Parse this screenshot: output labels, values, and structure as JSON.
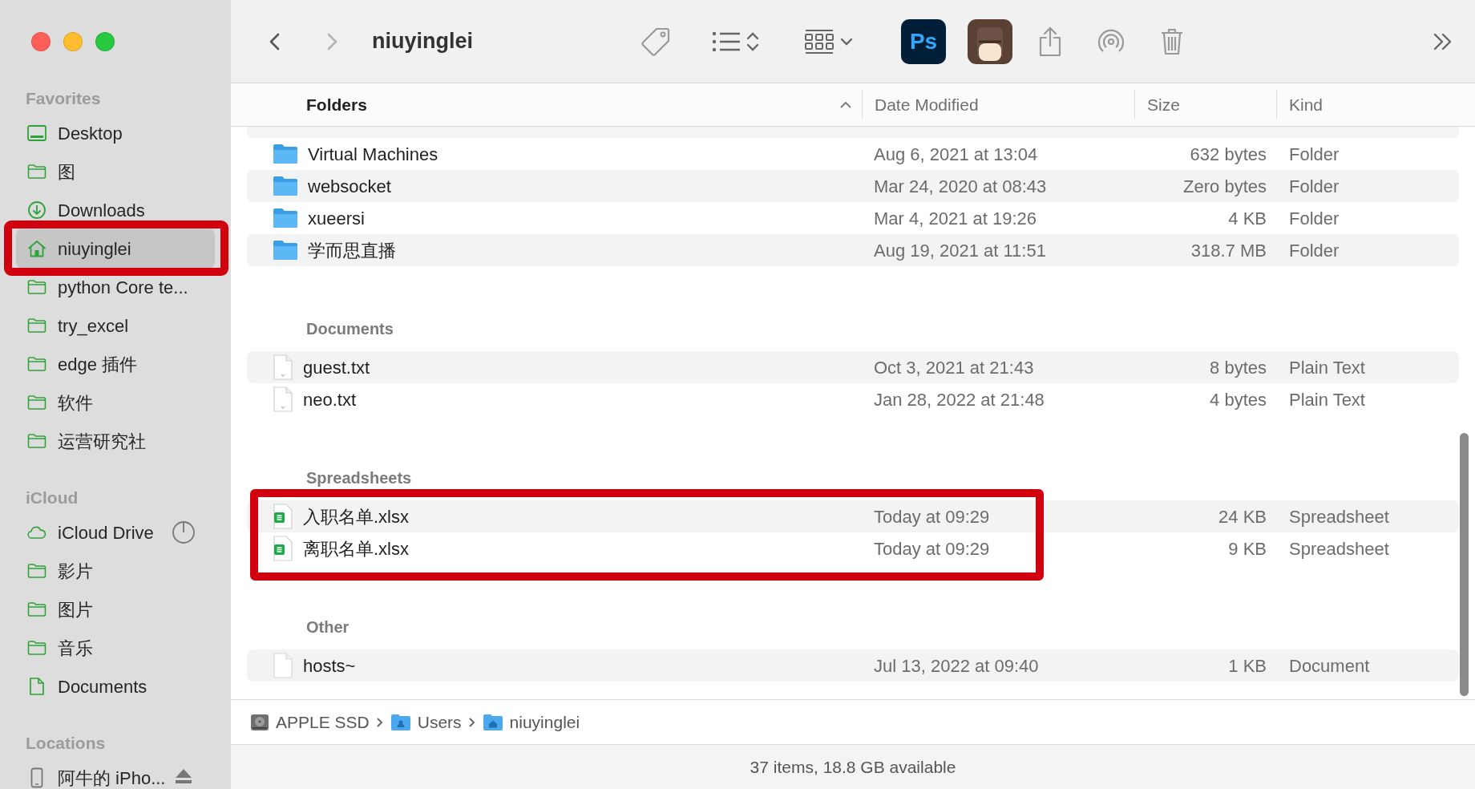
{
  "window": {
    "title": "niuyinglei"
  },
  "navigation": [
    {
      "kind": "back",
      "disabled": false
    },
    {
      "kind": "forward",
      "disabled": true
    }
  ],
  "toolbar": [
    {
      "kind": "tag"
    },
    {
      "kind": "list-view"
    },
    {
      "kind": "grid-view"
    },
    {
      "kind": "photoshop",
      "label": "Ps"
    },
    {
      "kind": "app"
    },
    {
      "kind": "share"
    },
    {
      "kind": "airdrop"
    },
    {
      "kind": "trash"
    },
    {
      "kind": "more"
    }
  ],
  "sidebar": {
    "sections": [
      {
        "title": "Favorites",
        "items": [
          {
            "label": "Desktop",
            "kind": "desktop",
            "selected": false,
            "annotated": false
          },
          {
            "label": "图",
            "kind": "folder",
            "selected": false,
            "annotated": false
          },
          {
            "label": "Downloads",
            "kind": "downloads",
            "selected": false,
            "annotated": false
          },
          {
            "label": "niuyinglei",
            "kind": "home",
            "selected": true,
            "annotated": true
          },
          {
            "label": "python Core te...",
            "kind": "folder",
            "selected": false,
            "annotated": false
          },
          {
            "label": "try_excel",
            "kind": "folder",
            "selected": false,
            "annotated": false
          },
          {
            "label": "edge 插件",
            "kind": "folder",
            "selected": false,
            "annotated": false
          },
          {
            "label": "软件",
            "kind": "folder",
            "selected": false,
            "annotated": false
          },
          {
            "label": "运营研究社",
            "kind": "folder",
            "selected": false,
            "annotated": false
          }
        ]
      },
      {
        "title": "iCloud",
        "items": [
          {
            "label": "iCloud Drive",
            "kind": "cloud",
            "selected": false,
            "annotated": false
          },
          {
            "label": "影片",
            "kind": "folder",
            "selected": false,
            "annotated": false
          },
          {
            "label": "图片",
            "kind": "folder",
            "selected": false,
            "annotated": false
          },
          {
            "label": "音乐",
            "kind": "folder",
            "selected": false,
            "annotated": false
          },
          {
            "label": "Documents",
            "kind": "document",
            "selected": false,
            "annotated": false
          }
        ]
      },
      {
        "title": "Locations",
        "items": [
          {
            "label": "阿牛的 iPho...",
            "kind": "device",
            "selected": false,
            "annotated": false
          }
        ]
      }
    ]
  },
  "table": {
    "columns": [
      {
        "label": "Folders",
        "sorted": true
      },
      {
        "label": "Date Modified",
        "sorted": false
      },
      {
        "label": "Size",
        "sorted": false
      },
      {
        "label": "Kind",
        "sorted": false
      }
    ],
    "groups": [
      {
        "annotated": false,
        "rows": [
          {
            "kind": "folder",
            "name": "Virtual Machines",
            "date": "Aug 6, 2021 at 13:04",
            "size": "632 bytes",
            "file_kind": "Folder",
            "shaded": false
          },
          {
            "kind": "folder",
            "name": "websocket",
            "date": "Mar 24, 2020 at 08:43",
            "size": "Zero bytes",
            "file_kind": "Folder",
            "shaded": true
          },
          {
            "kind": "folder",
            "name": "xueersi",
            "date": "Mar 4, 2021 at 19:26",
            "size": "4 KB",
            "file_kind": "Folder",
            "shaded": false
          },
          {
            "kind": "folder",
            "name": "学而思直播",
            "date": "Aug 19, 2021 at 11:51",
            "size": "318.7 MB",
            "file_kind": "Folder",
            "shaded": true
          }
        ]
      },
      {
        "title": "Documents",
        "annotated": false,
        "rows": [
          {
            "kind": "text",
            "name": "guest.txt",
            "date": "Oct 3, 2021 at 21:43",
            "size": "8 bytes",
            "file_kind": "Plain Text",
            "shaded": true
          },
          {
            "kind": "text",
            "name": "neo.txt",
            "date": "Jan 28, 2022 at 21:48",
            "size": "4 bytes",
            "file_kind": "Plain Text",
            "shaded": false
          }
        ]
      },
      {
        "title": "Spreadsheets",
        "annotated": true,
        "rows": [
          {
            "kind": "spreadsheet",
            "name": "入职名单.xlsx",
            "date": "Today at 09:29",
            "size": "24 KB",
            "file_kind": "Spreadsheet",
            "shaded": true
          },
          {
            "kind": "spreadsheet",
            "name": "离职名单.xlsx",
            "date": "Today at 09:29",
            "size": "9 KB",
            "file_kind": "Spreadsheet",
            "shaded": false
          }
        ]
      },
      {
        "title": "Other",
        "annotated": false,
        "rows": [
          {
            "kind": "document",
            "name": "hosts~",
            "date": "Jul 13, 2022 at 09:40",
            "size": "1 KB",
            "file_kind": "Document",
            "shaded": true
          }
        ]
      }
    ]
  },
  "path_bar": [
    {
      "label": "APPLE SSD",
      "kind": "disk"
    },
    {
      "label": "Users",
      "kind": "users"
    },
    {
      "label": "niuyinglei",
      "kind": "home"
    }
  ],
  "status_bar": "37 items, 18.8 GB available"
}
